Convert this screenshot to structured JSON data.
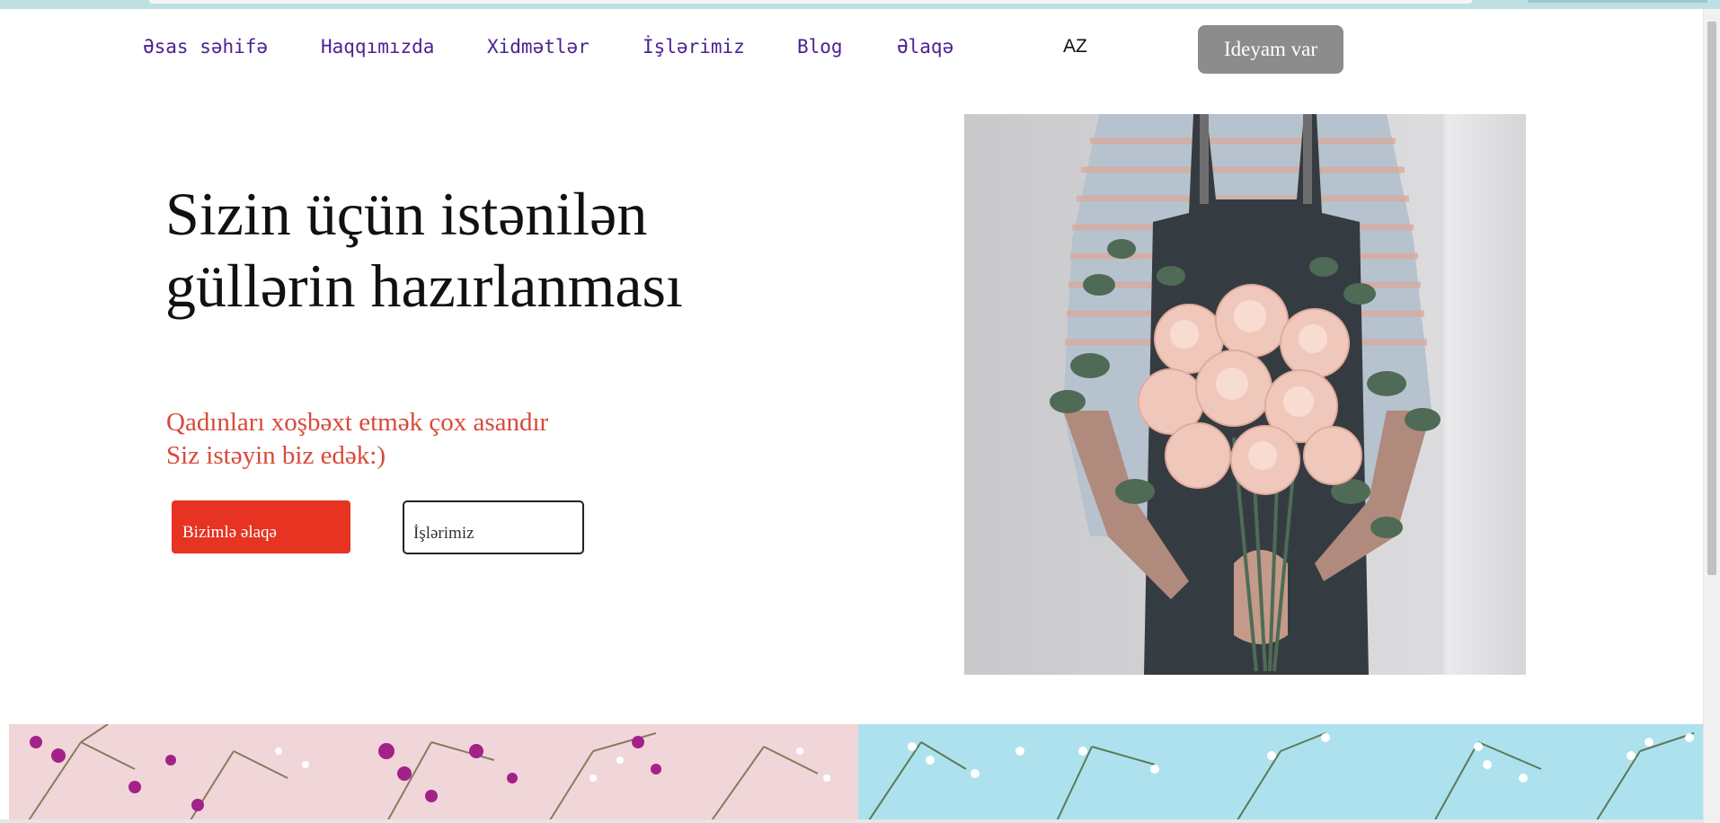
{
  "nav": {
    "items": [
      {
        "label": "Əsas səhifə"
      },
      {
        "label": "Haqqımızda"
      },
      {
        "label": "Xidmətlər"
      },
      {
        "label": "İşlərimiz"
      },
      {
        "label": "Blog"
      },
      {
        "label": "Əlaqə"
      }
    ],
    "language": "AZ",
    "cta_label": "Ideyam var"
  },
  "hero": {
    "title_line1": "Sizin üçün istənilən",
    "title_line2": "güllərin hazırlanması",
    "subtitle_line1": "Qadınları xoşbəxt etmək çox asandır",
    "subtitle_line2": "Siz istəyin biz edək:)",
    "primary_button": "Bizimlə əlaqə",
    "secondary_button": "İşlərimiz"
  },
  "colors": {
    "nav_link": "#4a2393",
    "accent_red": "#e63322",
    "subtitle": "#d8493a",
    "cta_gray": "#8c8c8c",
    "banner_pink": "#f1d6d9",
    "banner_blue": "#aee1ee"
  }
}
